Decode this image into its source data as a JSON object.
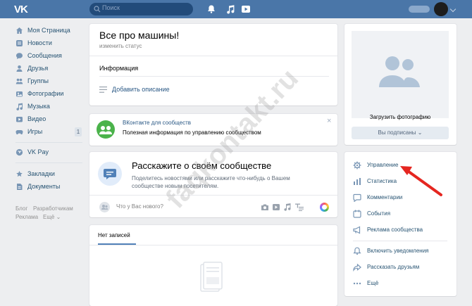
{
  "header": {
    "logo": "VK",
    "search_placeholder": "Поиск",
    "icons": [
      "bell-icon",
      "music-icon",
      "video-icon"
    ]
  },
  "left_menu": {
    "items": [
      {
        "label": "Моя Страница",
        "icon": "home-icon"
      },
      {
        "label": "Новости",
        "icon": "news-icon"
      },
      {
        "label": "Сообщения",
        "icon": "messages-icon"
      },
      {
        "label": "Друзья",
        "icon": "friends-icon"
      },
      {
        "label": "Группы",
        "icon": "groups-icon"
      },
      {
        "label": "Фотографии",
        "icon": "photos-icon"
      },
      {
        "label": "Музыка",
        "icon": "music-icon"
      },
      {
        "label": "Видео",
        "icon": "video-icon"
      },
      {
        "label": "Игры",
        "icon": "games-icon",
        "badge": "1"
      },
      {
        "label": "VK Pay",
        "icon": "vkpay-icon"
      },
      {
        "label": "Закладки",
        "icon": "bookmarks-icon"
      },
      {
        "label": "Документы",
        "icon": "documents-icon"
      }
    ],
    "footer": {
      "blog": "Блог",
      "developers": "Разработчикам",
      "ads": "Реклама",
      "more": "Ещё ⌄"
    }
  },
  "profile": {
    "name": "Все про машины!",
    "status": "изменить статус",
    "info": "Информация",
    "add_description": "Добавить описание"
  },
  "promo": {
    "title": "ВКонтакте для сообществ",
    "text": "Полезная информация по управлению сообществом",
    "close": "×"
  },
  "post": {
    "title": "Расскажите о своём сообществе",
    "description": "Поделитесь новостями или расскажите что-нибудь о Вашем сообществе новым посетителям.",
    "what_new": "Что у Вас нового?"
  },
  "wall": {
    "tab": "Нет записей"
  },
  "photo": {
    "upload": "Загрузить фотографию",
    "subscribed": "Вы подписаны ⌄"
  },
  "manage_menu": {
    "items": [
      {
        "label": "Управление",
        "icon": "gear-icon"
      },
      {
        "label": "Статистика",
        "icon": "stats-icon"
      },
      {
        "label": "Комментарии",
        "icon": "comments-icon"
      },
      {
        "label": "События",
        "icon": "events-icon"
      },
      {
        "label": "Реклама сообщества",
        "icon": "megaphone-icon"
      },
      {
        "label": "Включить уведомления",
        "icon": "bell-icon"
      },
      {
        "label": "Рассказать друзьям",
        "icon": "share-icon"
      },
      {
        "label": "Ещё",
        "icon": "more-icon"
      }
    ]
  },
  "watermark": "faqkontakt.ru",
  "colors": {
    "header": "#4a76a8",
    "link": "#2a5885",
    "accent_arrow": "#e52620",
    "background": "#edeef0"
  }
}
